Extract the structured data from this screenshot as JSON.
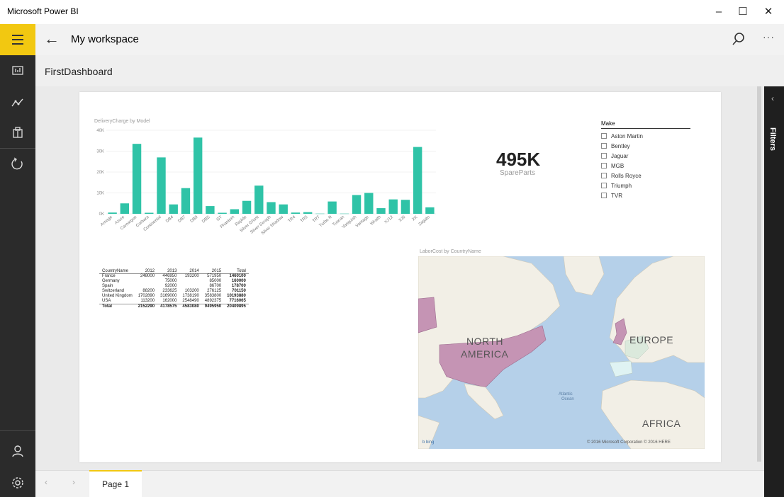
{
  "window": {
    "app_title": "Microsoft Power BI",
    "minimize_glyph": "–",
    "maximize_glyph": "☐",
    "close_glyph": "✕"
  },
  "navbar": {
    "workspace_title": "My workspace",
    "back_glyph": "←",
    "more_glyph": "···"
  },
  "breadcrumb": {
    "dashboard_name": "FirstDashboard"
  },
  "rail": {
    "icons": [
      "reports-icon",
      "dashboards-icon",
      "datasets-icon",
      "refresh-icon",
      "account-icon",
      "settings-icon"
    ]
  },
  "filters_pane": {
    "label": "Filters",
    "collapse_glyph": "‹"
  },
  "bar_chart": {
    "title": "DeliveryCharge by Model"
  },
  "kpi": {
    "value": "495K",
    "label": "SpareParts"
  },
  "slicer": {
    "header": "Make",
    "items": [
      "Aston Martin",
      "Bentley",
      "Jaguar",
      "MGB",
      "Rolls Royce",
      "Triumph",
      "TVR"
    ]
  },
  "table": {
    "headers": [
      "CountryName",
      "2012",
      "2013",
      "2014",
      "2015",
      "Total"
    ],
    "rows": [
      [
        "France",
        "248000",
        "446950",
        "193200",
        "571950",
        "1460100"
      ],
      [
        "Germany",
        "",
        "75000",
        "",
        "85000",
        "160000"
      ],
      [
        "Spain",
        "",
        "92000",
        "",
        "86700",
        "178700"
      ],
      [
        "Switzerland",
        "88200",
        "233625",
        "103200",
        "276125",
        "701150"
      ],
      [
        "United Kingdom",
        "1702890",
        "3169000",
        "1738190",
        "3583800",
        "10193880"
      ],
      [
        "USA",
        "113200",
        "162000",
        "2548490",
        "4892375",
        "7716065"
      ]
    ],
    "total_row": [
      "Total",
      "2152290",
      "4178575",
      "4583080",
      "9495950",
      "20409895"
    ]
  },
  "map": {
    "title": "LaborCost by CountryName",
    "label_north_america_1": "NORTH",
    "label_north_america_2": "AMERICA",
    "label_europe": "EUROPE",
    "label_africa": "AFRICA",
    "label_ocean_1": "Atlantic",
    "label_ocean_2": "Ocean",
    "label_bing": "b bing",
    "copyright": "© 2016 Microsoft Corporation   © 2016 HERE"
  },
  "pages": {
    "active_tab": "Page 1",
    "prev_glyph": "‹",
    "next_glyph": "›"
  },
  "colors": {
    "accent_yellow": "#f2c811",
    "bar_teal": "#2fc3a7",
    "rail_dark": "#2b2b2b",
    "map_water": "#b5d0e9",
    "map_land": "#f2efe6",
    "map_highlight": "#c594b4"
  },
  "chart_data": {
    "type": "bar",
    "title": "DeliveryCharge by Model",
    "categories": [
      "Arnage",
      "Azure",
      "Camargue",
      "Corbara",
      "Continental",
      "DB4",
      "DB7",
      "DB9",
      "DBS",
      "GT",
      "Phantom",
      "Rapide",
      "Silver Ghost",
      "Silver Seraph",
      "Silver Shadow",
      "TR4",
      "TR5",
      "TR7",
      "Turbo R",
      "Tuscan",
      "Vanquish",
      "Vantage",
      "Wraith",
      "XJ12",
      "XJ6",
      "XK",
      "Zagato"
    ],
    "values": [
      600,
      5000,
      33500,
      500,
      27000,
      4500,
      12300,
      36500,
      3700,
      500,
      2200,
      6200,
      13500,
      5600,
      4500,
      600,
      800,
      100,
      5900,
      100,
      9000,
      10000,
      2700,
      6900,
      6700,
      32000,
      3100
    ],
    "ylim": [
      0,
      40000
    ],
    "yticks": [
      "0K",
      "10K",
      "20K",
      "30K",
      "40K"
    ],
    "grid": true
  }
}
